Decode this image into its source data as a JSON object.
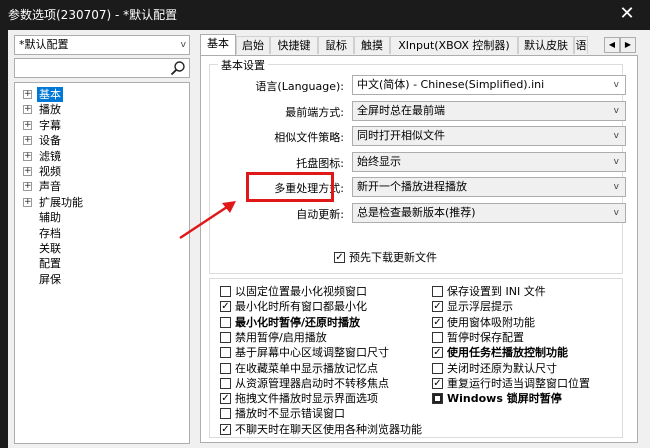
{
  "window": {
    "title": "参数选项(230707) - *默认配置",
    "close_glyph": "✕"
  },
  "sidebar": {
    "profile": "*默认配置",
    "search_value": "",
    "tree": [
      {
        "label": "基本",
        "expandable": true,
        "selected": true
      },
      {
        "label": "播放",
        "expandable": true
      },
      {
        "label": "字幕",
        "expandable": true
      },
      {
        "label": "设备",
        "expandable": true
      },
      {
        "label": "滤镜",
        "expandable": true
      },
      {
        "label": "视频",
        "expandable": true
      },
      {
        "label": "声音",
        "expandable": true
      },
      {
        "label": "扩展功能",
        "expandable": true
      },
      {
        "label": "辅助",
        "expandable": false
      },
      {
        "label": "存档",
        "expandable": false
      },
      {
        "label": "关联",
        "expandable": false
      },
      {
        "label": "配置",
        "expandable": false
      },
      {
        "label": "屏保",
        "expandable": false
      }
    ]
  },
  "tabs": [
    "基本",
    "启始",
    "快捷键",
    "鼠标",
    "触摸",
    "XInput(XBOX 控制器)",
    "默认皮肤",
    "语"
  ],
  "active_tab": 0,
  "tab_scroll": {
    "left": "◀",
    "right": "▶"
  },
  "basic": {
    "group_title": "基本设置",
    "settings": [
      {
        "label": "语言(Language):",
        "value": "中文(简体) - Chinese(Simplified).ini"
      },
      {
        "label": "最前端方式:",
        "value": "全屏时总在最前端"
      },
      {
        "label": "相似文件策略:",
        "value": "同时打开相似文件"
      },
      {
        "label": "托盘图标:",
        "value": "始终显示"
      },
      {
        "label": "多重处理方式:",
        "value": "新开一个播放进程播放"
      },
      {
        "label": "自动更新:",
        "value": "总是检查最新版本(推荐)"
      }
    ],
    "download_check": {
      "label": "预先下载更新文件",
      "checked": true
    }
  },
  "options_left": [
    {
      "label": "以固定位置最小化视频窗口",
      "state": "unchecked",
      "bold": false
    },
    {
      "label": "最小化时所有窗口都最小化",
      "state": "checked",
      "bold": false
    },
    {
      "label": "最小化时暂停/还原时播放",
      "state": "unchecked",
      "bold": true
    },
    {
      "label": "禁用暂停/启用播放",
      "state": "unchecked",
      "bold": false
    },
    {
      "label": "基于屏幕中心区域调整窗口尺寸",
      "state": "unchecked",
      "bold": false
    },
    {
      "label": "在收藏菜单中显示播放记忆点",
      "state": "unchecked",
      "bold": false
    },
    {
      "label": "从资源管理器启动时不转移焦点",
      "state": "unchecked",
      "bold": false
    },
    {
      "label": "拖拽文件播放时显示界面选项",
      "state": "checked",
      "bold": false
    },
    {
      "label": "播放时不显示错误窗口",
      "state": "unchecked",
      "bold": false
    },
    {
      "label": "不聊天时在聊天区使用各种浏览器功能",
      "state": "checked",
      "bold": false
    }
  ],
  "options_right": [
    {
      "label": "保存设置到 INI 文件",
      "state": "unchecked",
      "bold": false
    },
    {
      "label": "显示浮层提示",
      "state": "checked",
      "bold": false
    },
    {
      "label": "使用窗体吸附功能",
      "state": "checked",
      "bold": false
    },
    {
      "label": "暂停时保存配置",
      "state": "unchecked",
      "bold": false
    },
    {
      "label": "使用任务栏播放控制功能",
      "state": "checked",
      "bold": true
    },
    {
      "label": "关闭时还原为默认尺寸",
      "state": "unchecked",
      "bold": false
    },
    {
      "label": "重复运行时适当调整窗口位置",
      "state": "checked",
      "bold": false
    },
    {
      "label": "Windows 锁屏时暂停",
      "state": "indeterminate",
      "bold": true
    }
  ],
  "colors": {
    "titlebar": "#1b1b1b",
    "selection": "#0078d7",
    "annotation": "#e01818"
  }
}
